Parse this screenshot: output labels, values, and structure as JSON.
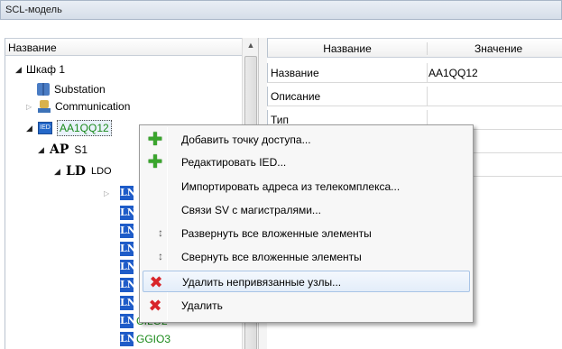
{
  "window": {
    "title": "SCL-модель"
  },
  "tree": {
    "header": "Название",
    "nodes": [
      {
        "label": "Шкаф 1"
      },
      {
        "label": "Substation"
      },
      {
        "label": "Communication"
      },
      {
        "label": "AA1QQ12",
        "icon_text": "IED"
      },
      {
        "prefix": "AP",
        "label": "S1"
      },
      {
        "prefix": "LD",
        "label": "LDO"
      },
      {
        "badge": "LN",
        "label": "CILO2"
      },
      {
        "badge": "LN",
        "label": "GGIO3"
      }
    ],
    "ln_badge": "LN"
  },
  "properties": {
    "columns": [
      "Название",
      "Значение"
    ],
    "rows": [
      {
        "key": "Название",
        "value": "AA1QQ12"
      },
      {
        "key": "Описание",
        "value": ""
      },
      {
        "key": "Тип",
        "value": ""
      }
    ]
  },
  "context_menu": {
    "items": [
      {
        "label": "Добавить точку доступа...",
        "icon": "green-plus-icon"
      },
      {
        "label": "Редактировать IED...",
        "icon": "green-plus-icon"
      },
      {
        "label": "Импортировать адреса из телекомплекса...",
        "icon": ""
      },
      {
        "label": "Связи SV с магистралями...",
        "icon": ""
      },
      {
        "label": "Развернуть все вложенные элементы",
        "icon": "expand-all-icon"
      },
      {
        "label": "Свернуть все вложенные элементы",
        "icon": "collapse-all-icon"
      },
      {
        "label": "Удалить непривязанные узлы...",
        "icon": "red-x-icon"
      },
      {
        "label": "Удалить",
        "icon": "red-x-icon"
      }
    ]
  },
  "colors": {
    "accent_green": "#1a8a1a",
    "ln_blue": "#1f5cc8",
    "delete_red": "#d8262b"
  }
}
